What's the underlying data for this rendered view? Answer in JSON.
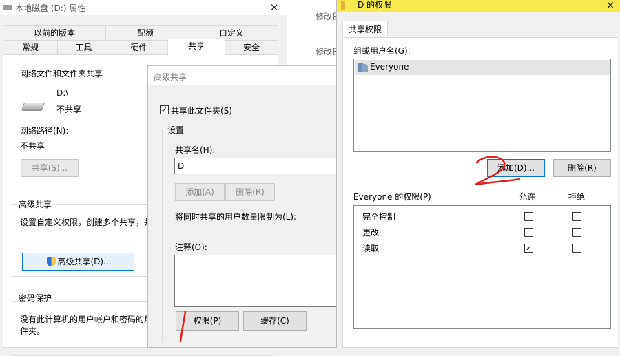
{
  "props": {
    "title": "本地磁盘 (D:) 属性",
    "tabs_row1": [
      "以前的版本",
      "配额",
      "自定义"
    ],
    "tabs_row2": [
      "常规",
      "工具",
      "硬件",
      "共享",
      "安全"
    ],
    "active_tab": "共享",
    "net_share_heading": "网络文件和文件夹共享",
    "drive_path": "D:\\",
    "drive_status": "不共享",
    "net_path_label": "网络路径(N):",
    "net_path_value": "不共享",
    "share_button": "共享(S)...",
    "adv_heading": "高级共享",
    "adv_desc": "设置自定义权限，创建多个共享，并",
    "adv_button": "高级共享(D)...",
    "pwd_heading": "密码保护",
    "pwd_desc_line1": "没有此计算机的用户帐户和密码的用",
    "pwd_desc_line2": "件夹。"
  },
  "bg_window": {
    "modified_label_1": "修改日",
    "modified_label_2": "修改日"
  },
  "adv": {
    "title": "高级共享",
    "share_checkbox_label": "共享此文件夹(S)",
    "share_checked": true,
    "settings_group": "设置",
    "share_name_label": "共享名(H):",
    "share_name_value": "D",
    "add_button": "添加(A)",
    "remove_button": "删除(R)",
    "limit_label": "将同时共享的用户数量限制为(L):",
    "comment_label": "注释(O):",
    "permissions_button": "权限(P)",
    "cache_button": "缓存(C)"
  },
  "perm": {
    "title": "D 的权限",
    "tab": "共享权限",
    "group_label": "组或用户名(G):",
    "users": [
      "Everyone"
    ],
    "add_button": "添加(D)...",
    "remove_button": "删除(R)",
    "perms_label": "Everyone 的权限(P)",
    "col_allow": "允许",
    "col_deny": "拒绝",
    "rows": [
      {
        "name": "完全控制",
        "allow": false,
        "deny": false
      },
      {
        "name": "更改",
        "allow": false,
        "deny": false
      },
      {
        "name": "读取",
        "allow": true,
        "deny": false
      }
    ]
  },
  "annotations": {
    "mark_1": "1",
    "mark_2": "2",
    "color": "#e02020"
  }
}
